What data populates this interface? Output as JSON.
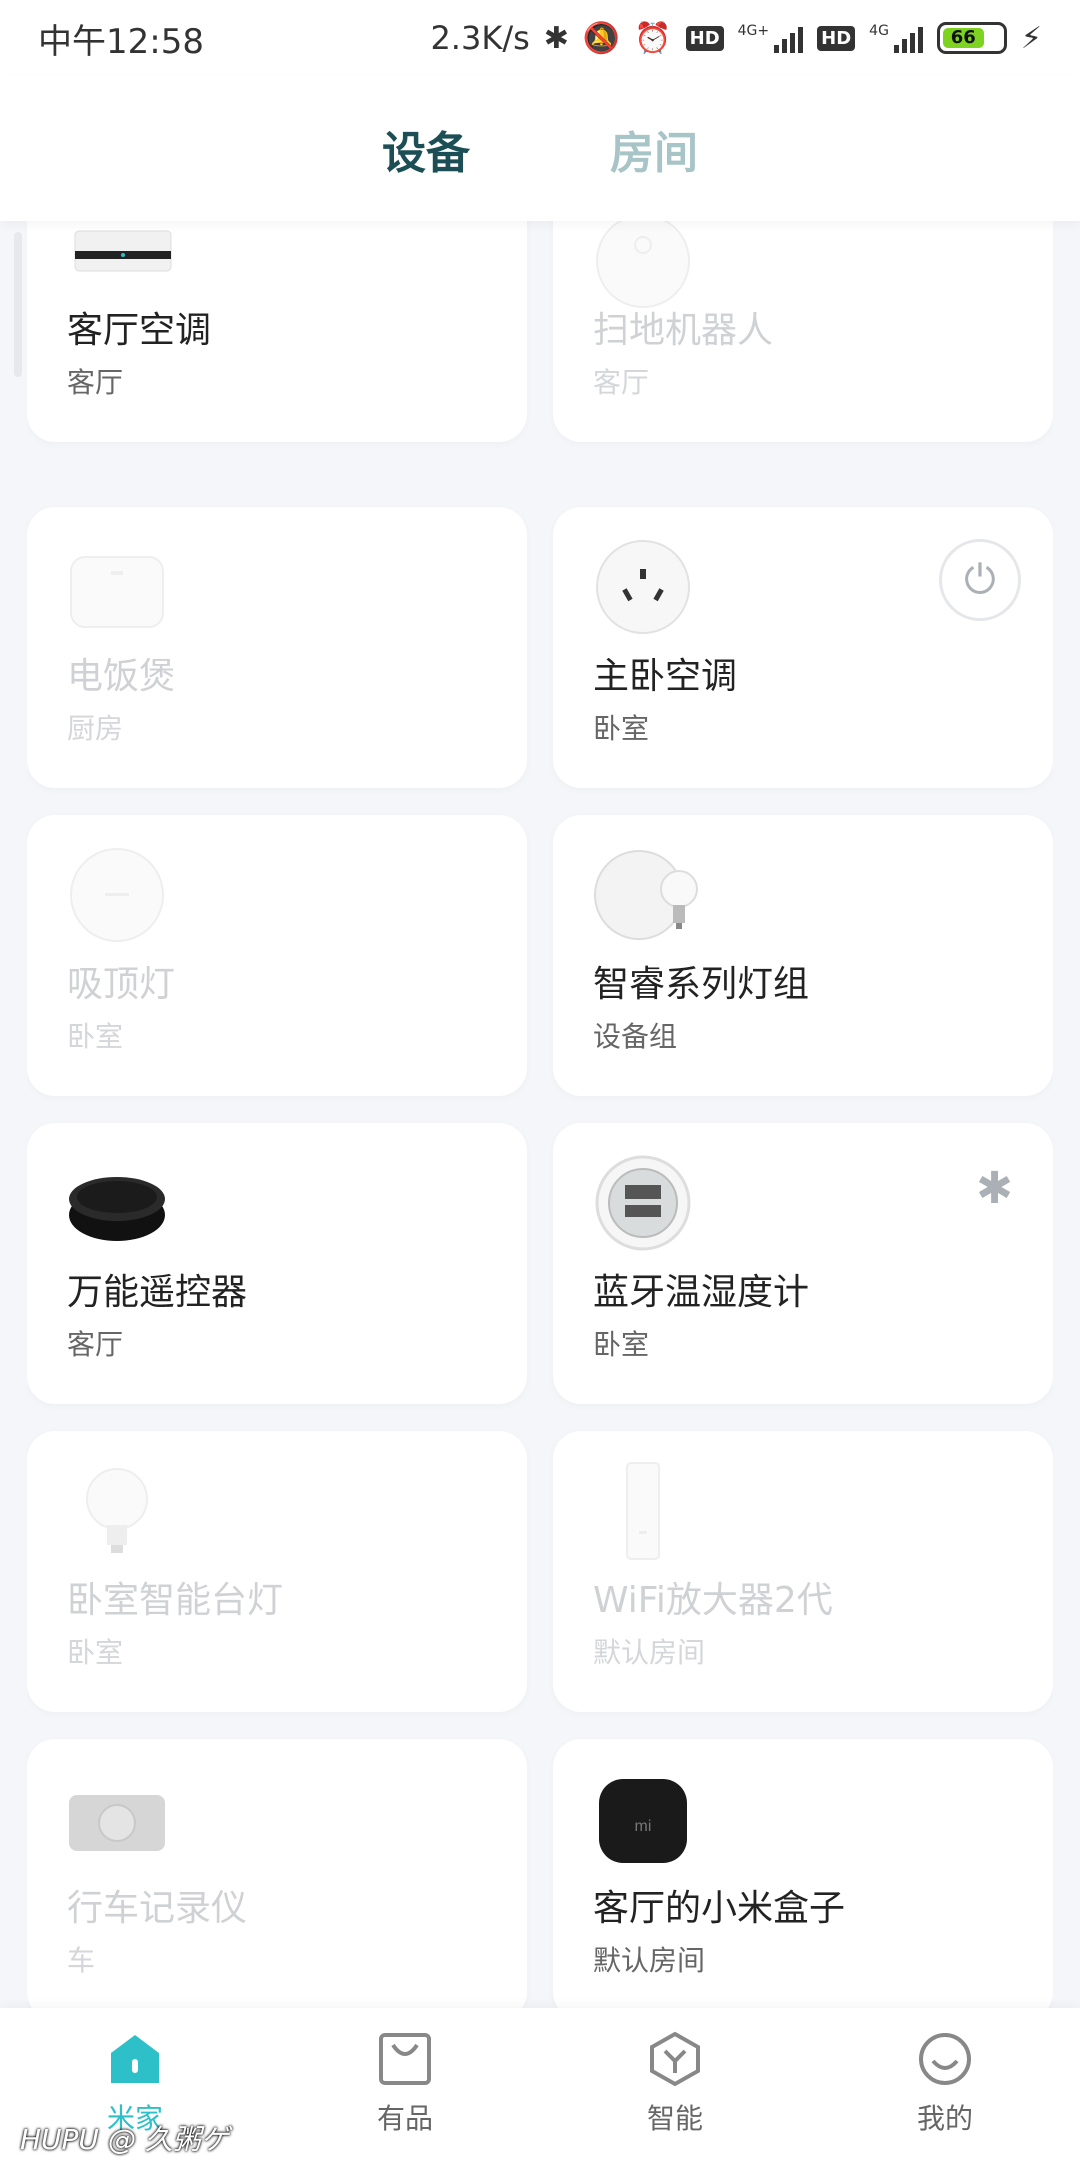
{
  "status_bar": {
    "time": "中午12:58",
    "speed": "2.3K/s",
    "hd1": "HD",
    "hd2": "HD",
    "net1": "4G+",
    "net2": "4G",
    "battery": "66"
  },
  "tabs": [
    {
      "label": "设备",
      "active": true
    },
    {
      "label": "房间",
      "active": false
    }
  ],
  "devices": [
    {
      "name": "客厅空调",
      "room": "客厅",
      "online": true,
      "icon": "ac-unit-icon"
    },
    {
      "name": "扫地机器人",
      "room": "客厅",
      "online": false,
      "icon": "robot-vacuum-icon"
    },
    {
      "name": "电饭煲",
      "room": "厨房",
      "online": false,
      "icon": "rice-cooker-icon"
    },
    {
      "name": "主卧空调",
      "room": "卧室",
      "online": true,
      "icon": "smart-plug-icon",
      "action": "power-icon"
    },
    {
      "name": "吸顶灯",
      "room": "卧室",
      "online": false,
      "icon": "ceiling-light-icon"
    },
    {
      "name": "智睿系列灯组",
      "room": "设备组",
      "online": true,
      "icon": "light-group-icon"
    },
    {
      "name": "万能遥控器",
      "room": "客厅",
      "online": true,
      "icon": "ir-remote-icon"
    },
    {
      "name": "蓝牙温湿度计",
      "room": "卧室",
      "online": true,
      "icon": "thermometer-icon",
      "action": "bluetooth-icon"
    },
    {
      "name": "卧室智能台灯",
      "room": "卧室",
      "online": false,
      "icon": "bulb-icon"
    },
    {
      "name": "WiFi放大器2代",
      "room": "默认房间",
      "online": false,
      "icon": "wifi-extender-icon"
    },
    {
      "name": "行车记录仪",
      "room": "车",
      "online": false,
      "icon": "dashcam-icon"
    },
    {
      "name": "客厅的小米盒子",
      "room": "默认房间",
      "online": true,
      "icon": "mi-box-icon"
    }
  ],
  "mi_box_logo": "mi",
  "bottom_nav": [
    {
      "label": "米家",
      "icon": "home-icon",
      "active": true
    },
    {
      "label": "有品",
      "icon": "shop-bag-icon",
      "active": false
    },
    {
      "label": "智能",
      "icon": "smart-cube-icon",
      "active": false
    },
    {
      "label": "我的",
      "icon": "profile-smile-icon",
      "active": false
    }
  ],
  "watermark": "HUPU @ 久粥ゲ",
  "colors": {
    "accent": "#2ec0c8",
    "tab_active": "#1c4e55",
    "tab_inactive": "#a7c4c7",
    "background": "#f5f6fa"
  }
}
